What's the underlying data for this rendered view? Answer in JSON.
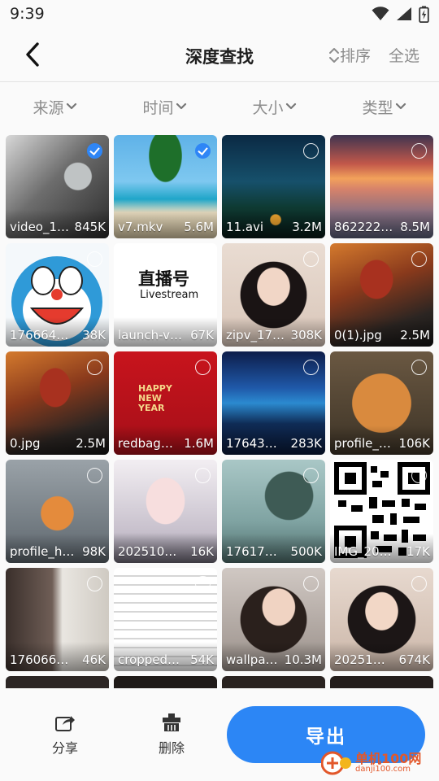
{
  "status": {
    "time": "9:39"
  },
  "header": {
    "title": "深度查找",
    "sort_label": "排序",
    "select_all_label": "全选"
  },
  "filters": [
    {
      "label": "来源"
    },
    {
      "label": "时间"
    },
    {
      "label": "大小"
    },
    {
      "label": "类型"
    }
  ],
  "files": [
    {
      "name": "video_1…",
      "size": "845K",
      "checked": true
    },
    {
      "name": "v7.mkv",
      "size": "5.6M",
      "checked": true
    },
    {
      "name": "11.avi",
      "size": "3.2M",
      "checked": false
    },
    {
      "name": "862222…",
      "size": "8.5M",
      "checked": false
    },
    {
      "name": "176664…",
      "size": "38K",
      "checked": false
    },
    {
      "name": "launch-v…",
      "size": "67K",
      "checked": false
    },
    {
      "name": "zipv_17…",
      "size": "308K",
      "checked": false
    },
    {
      "name": "0(1).jpg",
      "size": "2.5M",
      "checked": false
    },
    {
      "name": "0.jpg",
      "size": "2.5M",
      "checked": false
    },
    {
      "name": "redbag…",
      "size": "1.6M",
      "checked": false
    },
    {
      "name": "17643…",
      "size": "283K",
      "checked": false
    },
    {
      "name": "profile_…",
      "size": "106K",
      "checked": false
    },
    {
      "name": "profile_h…",
      "size": "98K",
      "checked": false
    },
    {
      "name": "202510…",
      "size": "16K",
      "checked": false
    },
    {
      "name": "17617…",
      "size": "500K",
      "checked": false
    },
    {
      "name": "IMG_20…",
      "size": "17K",
      "checked": false
    },
    {
      "name": "176066…",
      "size": "46K",
      "checked": false
    },
    {
      "name": "cropped…",
      "size": "54K",
      "checked": false
    },
    {
      "name": "wallpa…",
      "size": "10.3M",
      "checked": false
    },
    {
      "name": "20251…",
      "size": "674K",
      "checked": false
    },
    {
      "name": "",
      "size": "",
      "checked": false
    },
    {
      "name": "",
      "size": "",
      "checked": false
    },
    {
      "name": "",
      "size": "",
      "checked": false
    },
    {
      "name": "",
      "size": "",
      "checked": false
    }
  ],
  "thumb_texts": {
    "launch_brand": "直播号",
    "launch_sub": "Livestream",
    "redbag_text": "HAPPY NEW YEAR"
  },
  "bottom": {
    "share_label": "分享",
    "delete_label": "删除",
    "export_label": "导出"
  },
  "watermark": {
    "line1": "单机100网",
    "line2": "danji100.com"
  },
  "colors": {
    "accent": "#2c86f5",
    "muted_text": "#8c8c8c",
    "background": "#fafafa"
  }
}
